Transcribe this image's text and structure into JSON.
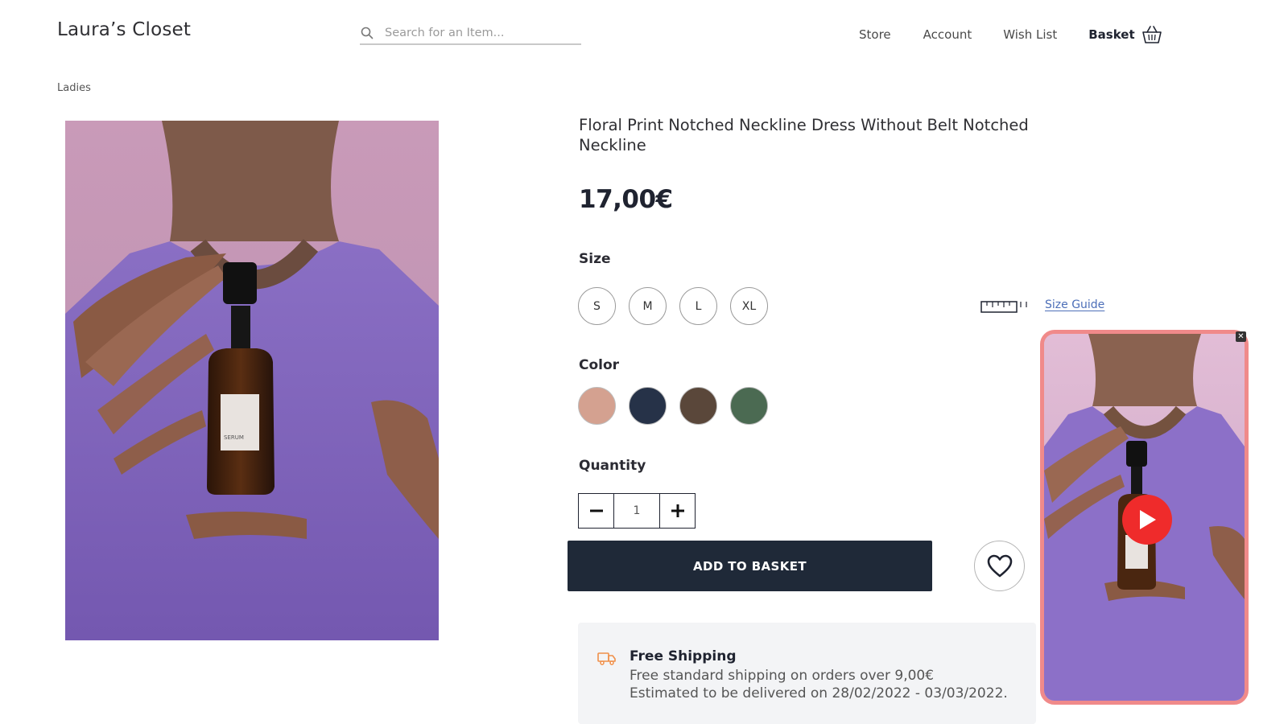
{
  "header": {
    "logo": "Laura’s Closet",
    "search": {
      "placeholder": "Search for an Item..."
    },
    "nav": {
      "store": "Store",
      "account": "Account",
      "wish_list": "Wish List",
      "basket": "Basket"
    }
  },
  "breadcrumb": "Ladies",
  "product": {
    "title": "Floral Print Notched Neckline Dress Without Belt Notched Neckline",
    "price": "17,00€",
    "image_text": "SERUM",
    "size": {
      "label": "Size",
      "options": [
        "S",
        "M",
        "L",
        "XL"
      ],
      "guide_label": "Size Guide"
    },
    "color": {
      "label": "Color",
      "swatches": [
        "#d4a190",
        "#263248",
        "#5a473a",
        "#4b6a52"
      ]
    },
    "quantity": {
      "label": "Quantity",
      "value": "1"
    },
    "add_to_basket": "ADD TO BASKET"
  },
  "shipping": {
    "title": "Free Shipping",
    "line1": "Free standard shipping on orders over 9,00€",
    "line2": "Estimated to be delivered on 28/02/2022 - 03/03/2022."
  },
  "colors": {
    "primary_button": "#1f2938",
    "link": "#4d6fb8",
    "video_border": "#f08a8a",
    "play": "#ef2b2b",
    "shipping_icon": "#f0904a"
  }
}
